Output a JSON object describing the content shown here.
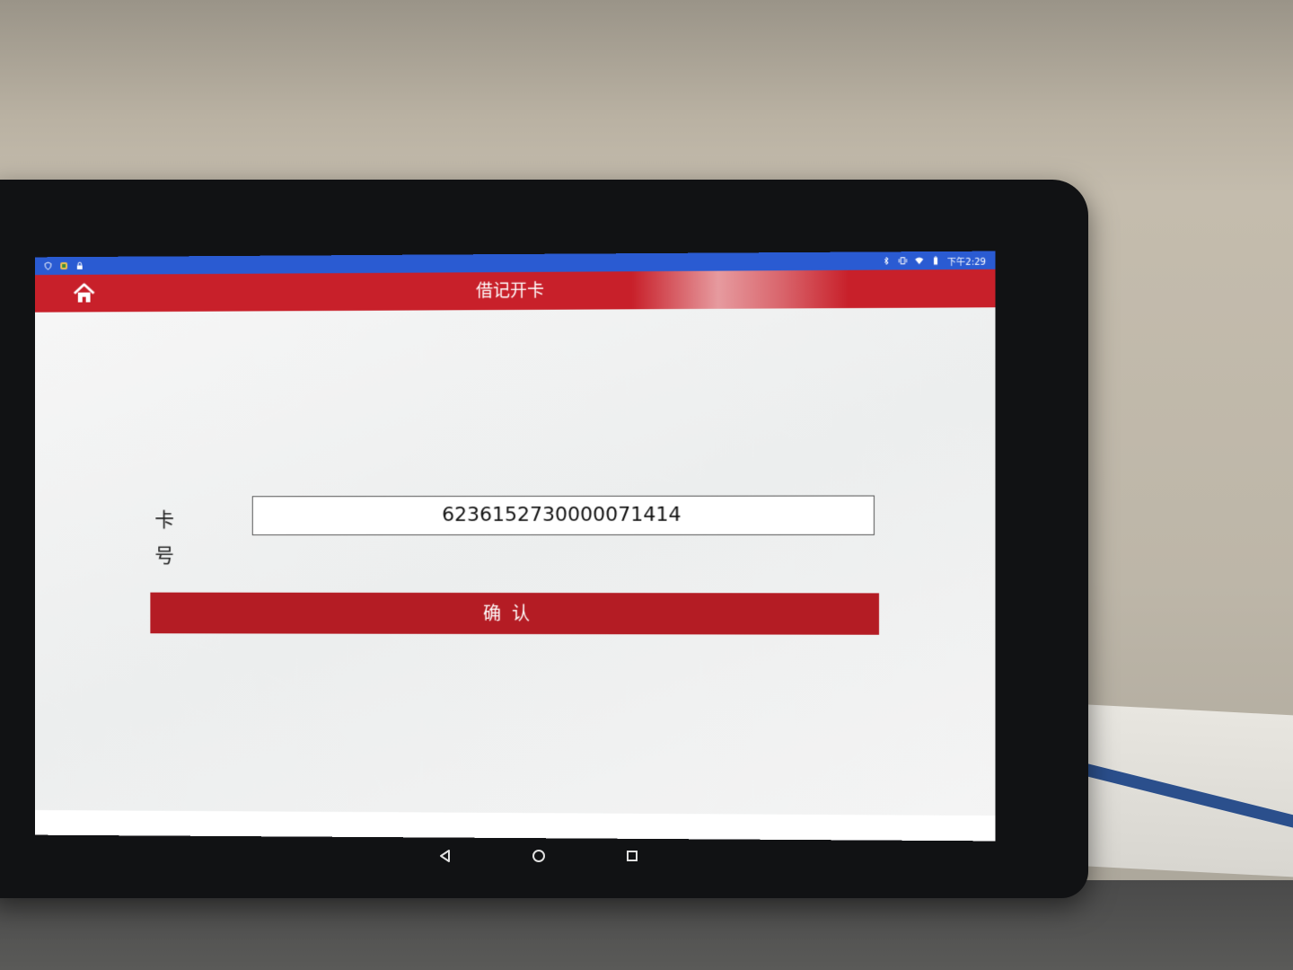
{
  "status_bar": {
    "time": "下午2:29",
    "left_icons": [
      "shield-icon",
      "app-icon",
      "lock-icon"
    ],
    "right_icons": [
      "bluetooth-icon",
      "vibrate-icon",
      "wifi-icon",
      "battery-icon"
    ]
  },
  "app_bar": {
    "title": "借记开卡",
    "home_icon": "home-icon"
  },
  "form": {
    "card_label": "卡号",
    "card_value": "6236152730000071414"
  },
  "confirm_button": {
    "label": "确认"
  },
  "nav": {
    "back_icon": "back-triangle-icon",
    "home_icon": "home-circle-icon",
    "recents_icon": "recents-square-icon"
  },
  "colors": {
    "status_bar": "#2a5bd2",
    "app_bar": "#c8202a",
    "button": "#b41c24"
  }
}
